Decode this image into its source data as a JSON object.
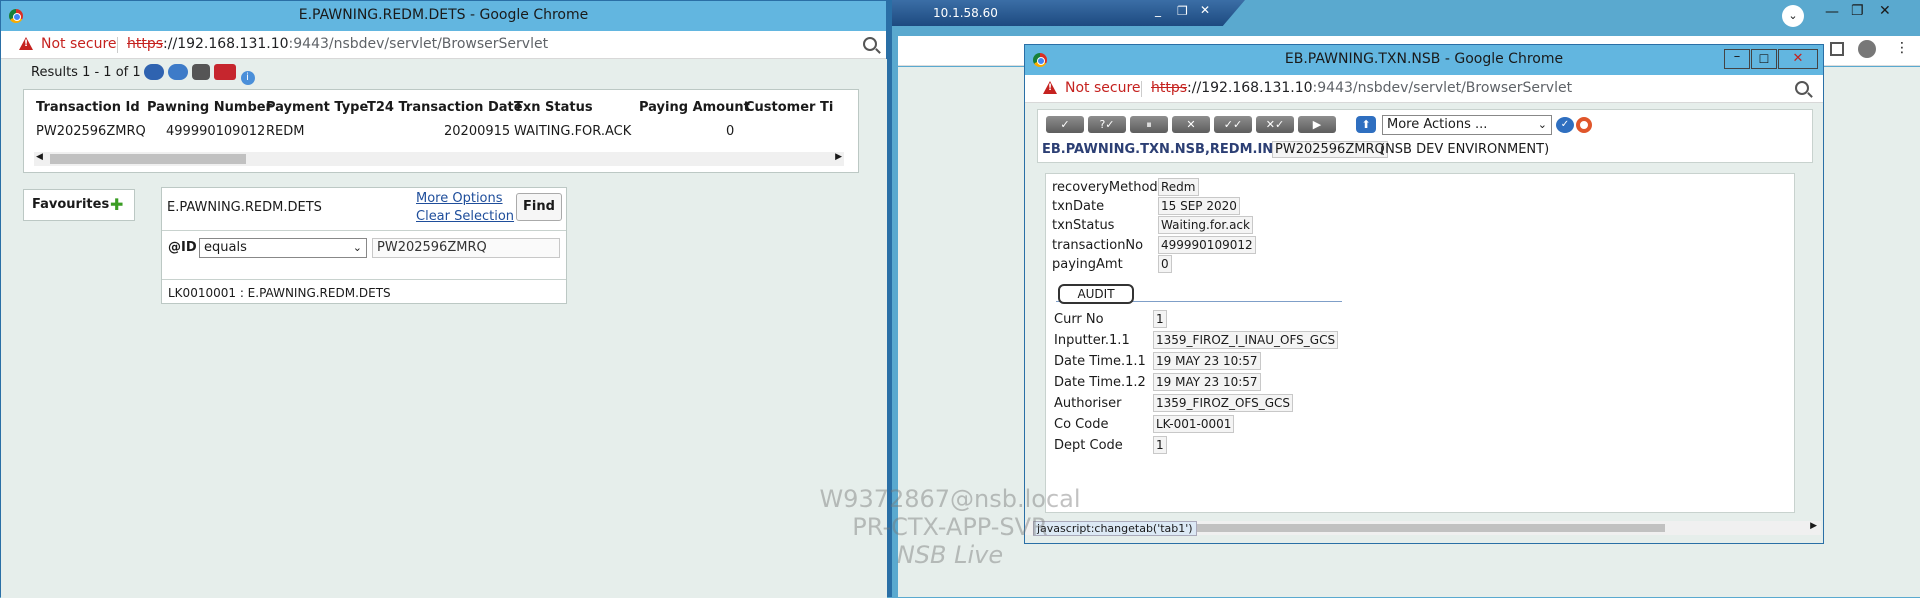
{
  "remote": {
    "ip": "10.1.58.60"
  },
  "left_window": {
    "title": "E.PAWNING.REDM.DETS - Google Chrome",
    "not_secure": "Not secure",
    "url_scheme": "https",
    "url_host": "://192.168.131.10",
    "url_rest": ":9443/nsbdev/servlet/BrowserServlet",
    "results": "Results 1 - 1 of 1",
    "table": {
      "headers": [
        "Transaction Id",
        "Pawning Number",
        "Payment Type",
        "T24 Transaction Date",
        "Txn Status",
        "Paying Amount",
        "Customer Ti"
      ],
      "rows": [
        [
          "PW202596ZMRQ",
          "499990109012",
          "REDM",
          "20200915",
          "WAITING.FOR.ACK",
          "0",
          ""
        ]
      ]
    },
    "favourites": "Favourites",
    "enquiry": {
      "name": "E.PAWNING.REDM.DETS",
      "more_options": "More Options",
      "clear_selection": "Clear Selection",
      "find": "Find",
      "field": "@ID",
      "operator": "equals",
      "value": "PW202596ZMRQ",
      "footer": "LK0010001 : E.PAWNING.REDM.DETS"
    }
  },
  "right_window": {
    "title": "EB.PAWNING.TXN.NSB - Google Chrome",
    "not_secure": "Not secure",
    "url_scheme": "https",
    "url_host": "://192.168.131.10",
    "url_rest": ":9443/nsbdev/servlet/BrowserServlet",
    "more_actions": "More Actions ...",
    "version": "EB.PAWNING.TXN.NSB,REDM.INPUT",
    "record_id": "PW202596ZMRQ",
    "environment": "(NSB DEV ENVIRONMENT)",
    "fields": [
      {
        "label": "recoveryMethod",
        "value": "Redm"
      },
      {
        "label": "txnDate",
        "value": "15 SEP 2020"
      },
      {
        "label": "txnStatus",
        "value": "Waiting.for.ack"
      },
      {
        "label": "transactionNo",
        "value": "499990109012"
      },
      {
        "label": "payingAmt",
        "value": "0"
      }
    ],
    "audit_tab": "AUDIT",
    "audit": [
      {
        "label": "Curr No",
        "value": "1"
      },
      {
        "label": "Inputter.1.1",
        "value": "1359_FIROZ_I_INAU_OFS_GCS"
      },
      {
        "label": "Date Time.1.1",
        "value": "19 MAY 23 10:57"
      },
      {
        "label": "Date Time.1.2",
        "value": "19 MAY 23 10:57"
      },
      {
        "label": "Authoriser",
        "value": "1359_FIROZ_OFS_GCS"
      },
      {
        "label": "Co Code",
        "value": "LK-001-0001"
      },
      {
        "label": "Dept Code",
        "value": "1"
      }
    ],
    "status_bar": "javascript:changetab('tab1')"
  },
  "watermark": [
    "W9372867@nsb.local",
    "PR-CTX-APP-SVR",
    "NSB Live"
  ],
  "colors": {
    "titlebar": "#62b6e0",
    "content_bg": "#e6eeeb",
    "accent": "#1f4e9b",
    "warning": "#c5221f"
  }
}
